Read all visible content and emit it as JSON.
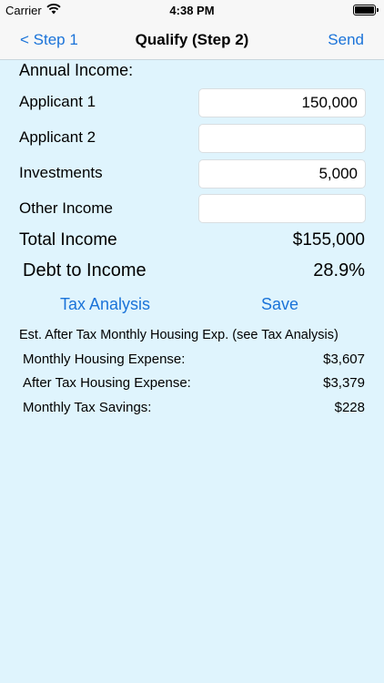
{
  "status_bar": {
    "carrier": "Carrier",
    "time": "4:38 PM"
  },
  "nav": {
    "back_label": "< Step 1",
    "title": "Qualify (Step 2)",
    "send_label": "Send"
  },
  "income": {
    "section_title": "Annual Income:",
    "rows": [
      {
        "label": "Applicant 1",
        "value": "150,000"
      },
      {
        "label": "Applicant 2",
        "value": ""
      },
      {
        "label": "Investments",
        "value": "5,000"
      },
      {
        "label": "Other Income",
        "value": ""
      }
    ]
  },
  "totals": {
    "total_label": "Total Income",
    "total_value": "$155,000",
    "dti_label": "Debt to Income",
    "dti_value": "28.9%"
  },
  "actions": {
    "tax_analysis_label": "Tax Analysis",
    "save_label": "Save"
  },
  "expenses": {
    "header": "Est. After Tax Monthly Housing Exp. (see Tax Analysis)",
    "rows": [
      {
        "label": "Monthly Housing Expense:",
        "value": "$3,607"
      },
      {
        "label": "After Tax Housing Expense:",
        "value": "$3,379"
      },
      {
        "label": "Monthly Tax Savings:",
        "value": "$228"
      }
    ]
  },
  "colors": {
    "background": "#dff4fd",
    "accent": "#1a73d9",
    "bar": "#f7f7f7"
  }
}
